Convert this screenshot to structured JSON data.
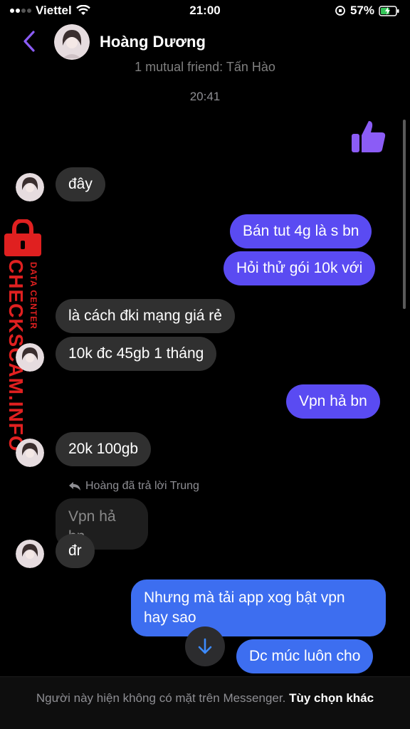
{
  "status_bar": {
    "carrier": "Viettel",
    "time": "21:00",
    "battery": "57%"
  },
  "header": {
    "contact_name": "Hoàng Dương"
  },
  "mutual_text": "1 mutual friend: Tấn Hào",
  "timestamp": "20:41",
  "messages": {
    "m1": "đây",
    "m2": "Bán tut 4g là s bn",
    "m3": "Hỏi thử gói 10k với",
    "m4": "là cách đki mạng giá rẻ",
    "m5": "10k đc 45gb 1 tháng",
    "m6": "Vpn hả bn",
    "m7": "20k 100gb",
    "reply_label": "Hoàng đã trả lời Trung",
    "m8_quote": "Vpn hả bn",
    "m8": "đr",
    "m9": "Nhưng mà tải app xog bật vpn hay sao",
    "m10": "Dc múc luôn cho"
  },
  "footer": {
    "notice": "Người này hiện không có mặt trên Messenger.",
    "more_options": "Tùy chọn khác"
  },
  "watermark": {
    "brand": "CHECKSCAM.INFO",
    "sub": "DATA CENTER"
  },
  "colors": {
    "outgoing_purple": "#5a4bf2",
    "outgoing_blue": "#3d6ef0",
    "incoming": "#303030",
    "accent": "#8b5cf6",
    "watermark_red": "#e02020"
  }
}
